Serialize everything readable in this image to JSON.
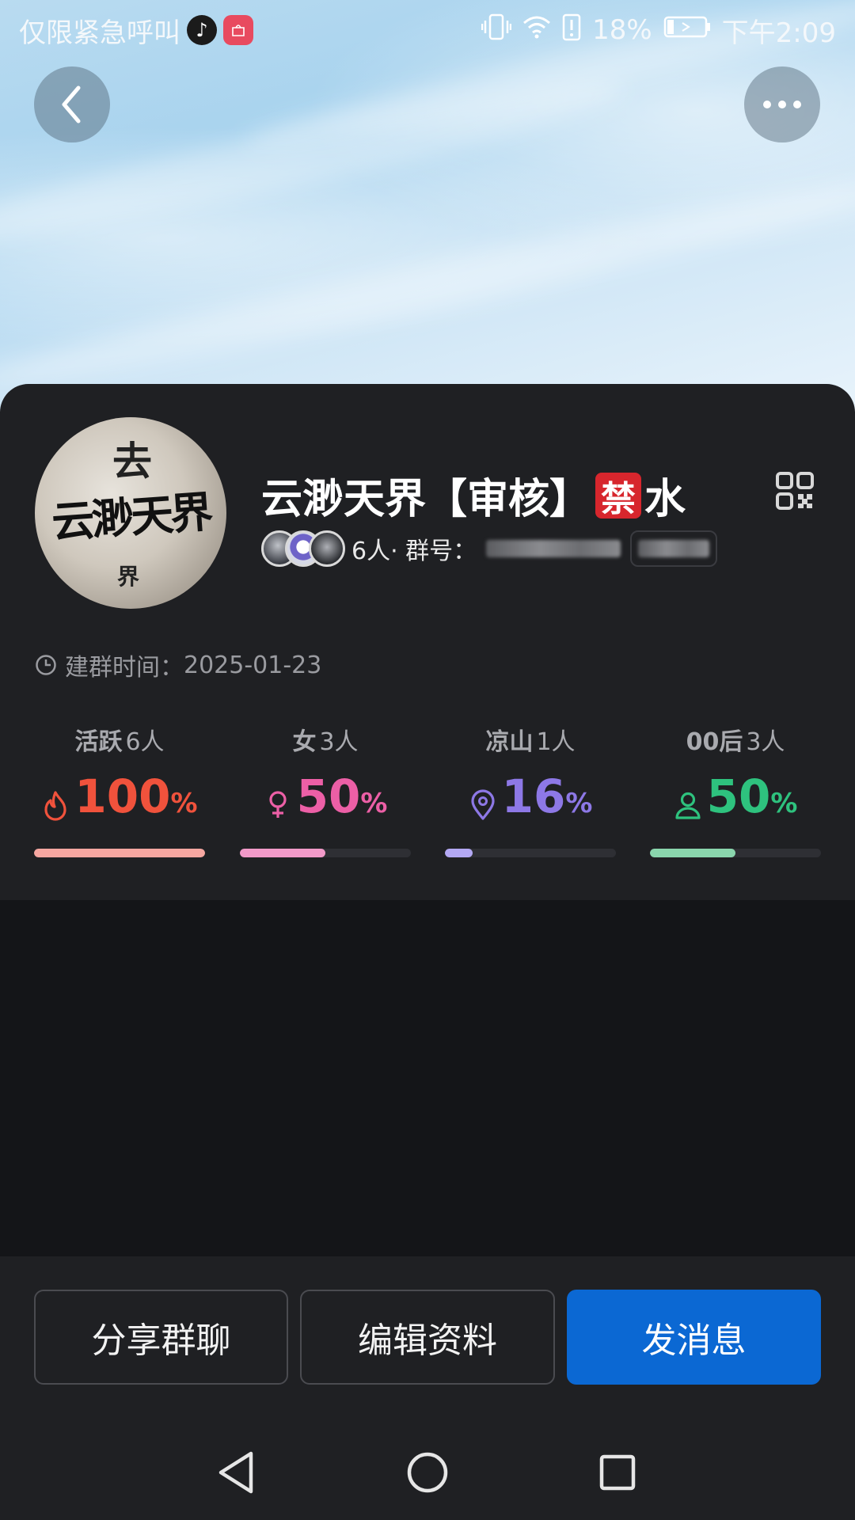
{
  "status_bar": {
    "left_text": "仅限紧急呼叫",
    "battery": "18%",
    "time": "下午2:09"
  },
  "group": {
    "name_part1": "云渺天界【审核】",
    "ban_badge": "禁",
    "name_part2": "水",
    "member_count": "6人",
    "group_no_label": "· 群号：",
    "created_label": "建群时间：",
    "created_date": "2025-01-23",
    "avatar_title": "云渺天界",
    "avatar_top": "去",
    "avatar_sub": "界"
  },
  "stats": [
    {
      "label": "活跃",
      "count": "6人",
      "value": "100",
      "unit": "%",
      "fraction": 1.0,
      "color": "#f0523c",
      "bar_color": "#f6a7a1",
      "icon": "fire-icon"
    },
    {
      "label": "女",
      "count": "3人",
      "value": "50",
      "unit": "%",
      "fraction": 0.5,
      "color": "#ec5fa6",
      "bar_color": "#f29ac9",
      "icon": "female-icon"
    },
    {
      "label": "凉山",
      "count": "1人",
      "value": "16",
      "unit": "%",
      "fraction": 0.16,
      "color": "#8d78e6",
      "bar_color": "#b3a8f3",
      "icon": "location-pin-icon"
    },
    {
      "label": "00后",
      "count": "3人",
      "value": "50",
      "unit": "%",
      "fraction": 0.5,
      "color": "#2ec27e",
      "bar_color": "#8ad6ad",
      "icon": "person-icon"
    }
  ],
  "buttons": {
    "share": "分享群聊",
    "edit": "编辑资料",
    "send": "发消息"
  },
  "colors": {
    "primary": "#0b68d3",
    "card_bg": "#1f2023"
  }
}
